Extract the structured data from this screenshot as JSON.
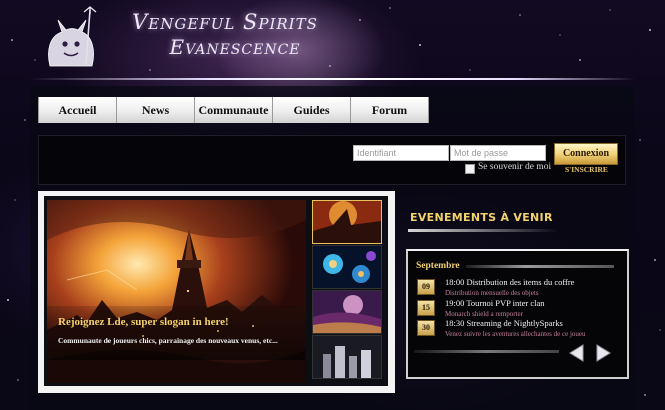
{
  "header": {
    "title_line1": "Vengeful Spirits",
    "title_line2": "Evanescence"
  },
  "nav": {
    "items": [
      {
        "label": "Accueil"
      },
      {
        "label": "News"
      },
      {
        "label": "Communaute"
      },
      {
        "label": "Guides"
      },
      {
        "label": "Forum"
      }
    ]
  },
  "login": {
    "username_placeholder": "Identifiant",
    "password_placeholder": "Mot de passe",
    "remember_label": "Se souvenir de moi",
    "submit_label": "Connexion",
    "register_label": "S'INSCRIRE"
  },
  "slider": {
    "caption_title": "Rejoignez Lde, super slogan in here!",
    "caption_text": "Communaute de joueurs chics, parrainage des nouveaux venus, etc...",
    "thumbnails": [
      {
        "icon": "fiery-city-thumbnail"
      },
      {
        "icon": "blue-flowers-thumbnail"
      },
      {
        "icon": "fantasy-landscape-thumbnail"
      },
      {
        "icon": "night-city-thumbnail"
      }
    ]
  },
  "events": {
    "heading": "EVENEMENTS À VENIR",
    "month": "Septembre",
    "items": [
      {
        "day": "09",
        "title": "18:00 Distribution des items du coffre",
        "subtitle": "Distribution mensuelle des objets"
      },
      {
        "day": "15",
        "title": "19:00 Tournoi PVP inter clan",
        "subtitle": "Monarch shield a remporter"
      },
      {
        "day": "30",
        "title": "18:30 Streaming de NightlySparks",
        "subtitle": "Venez suivre les aventures allechantes de ce joueu"
      }
    ],
    "prev_icon": "arrow-left-icon",
    "next_icon": "arrow-right-icon"
  },
  "colors": {
    "accent_gold": "#f2d26b",
    "event_subtitle": "#c67f9a",
    "background": "#0b0618"
  }
}
